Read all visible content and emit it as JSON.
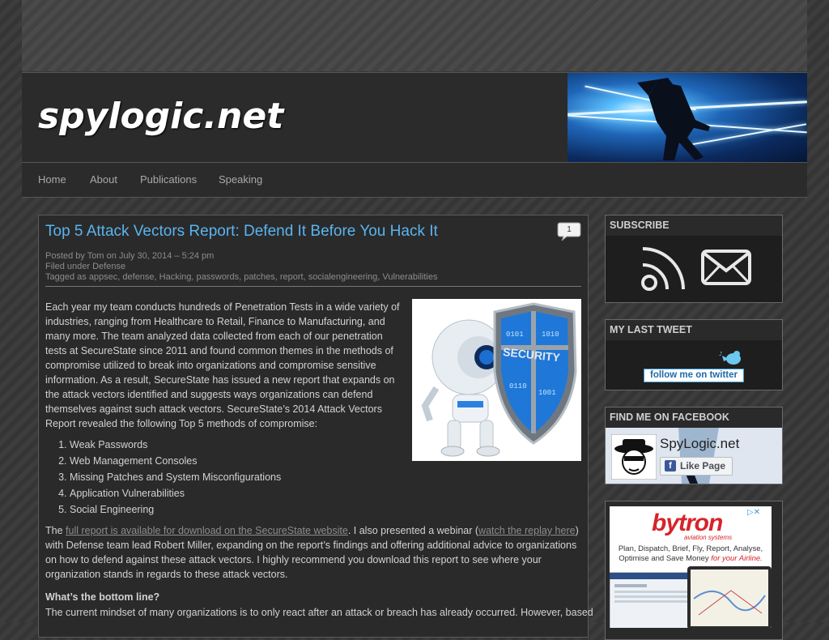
{
  "site": {
    "logo": "spylogic.net"
  },
  "nav": {
    "items": [
      "Home",
      "About",
      "Publications",
      "Speaking"
    ]
  },
  "post": {
    "title": "Top 5 Attack Vectors Report: Defend It Before You Hack It",
    "comment_count": "1",
    "posted_by": "Posted by Tom on July 30, 2014 – 5:24 pm",
    "filed_under": "Filed under Defense",
    "tagged": "Tagged as appsec, defense, Hacking, passwords, patches, report, socialengineering, Vulnerabilities",
    "intro": "Each year my team conducts hundreds of Penetration Tests in a wide variety of industries, ranging from Healthcare to Retail, Finance to Manufacturing, and many more. The team analyzed data collected from each of our penetration tests at SecureState since 2011 and found common themes in the methods of compromise utilized to break into organizations and compromise sensitive information. As a result, SecureState has issued a new report that expands on the attack vectors identified and suggests ways organizations can defend themselves against such attack vectors. SecureState’s 2014 Attack Vectors Report revealed the following Top 5 methods of compromise:",
    "figure_label": "SECURITY",
    "attack_vectors": [
      "Weak Passwords",
      "Web Management Consoles",
      "Missing Patches and System Misconfigurations",
      "Application Vulnerabilities",
      "Social Engineering"
    ],
    "para2_a": "The ",
    "para2_link1": "full report is available for download on the SecureState website",
    "para2_b": ". I also presented a webinar (",
    "para2_link2": "watch the replay here",
    "para2_c": ") with Defense team lead Robert Miller, expanding on the report’s findings and offering additional advice to organizations on how to defend against these attack vectors. I highly recommend you download this report to see where your organization stands in regards to these attack vectors.",
    "bottom_heading": "What’s the bottom line?",
    "para3": "The current mindset of many organizations is to only react after an attack or breach has already occurred. However, based"
  },
  "sidebar": {
    "subscribe": {
      "title": "SUBSCRIBE",
      "icons": [
        "rss-icon",
        "email-icon"
      ]
    },
    "tweet": {
      "title": "MY LAST TWEET",
      "button": "follow me on twitter"
    },
    "facebook": {
      "title": "FIND ME ON FACEBOOK",
      "page_name": "SpyLogic.net",
      "like_label": "Like Page"
    },
    "ad": {
      "brand": "bytron",
      "brand_sub": "aviation systems",
      "line1": "Plan, Dispatch, Brief, Fly, Report, Analyse,",
      "line2_a": "Optimise and Save Money ",
      "line2_b": "for your Airline.",
      "choices": "▷✕"
    }
  },
  "colors": {
    "link_blue": "#5ab4f0",
    "panel": "#2a2a2a",
    "ad_red": "#d8232a",
    "facebook_blue": "#3b5998"
  }
}
